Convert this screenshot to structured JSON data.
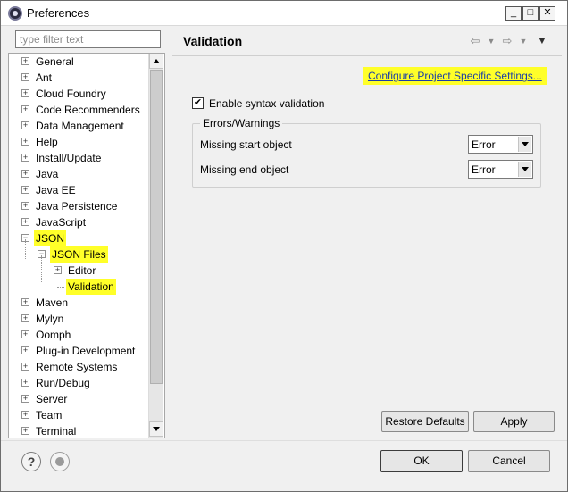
{
  "window": {
    "title": "Preferences",
    "minimize_icon": "minimize-icon",
    "maximize_icon": "maximize-icon",
    "close_icon": "close-icon"
  },
  "sidebar": {
    "filter_placeholder": "type filter text",
    "tree": [
      {
        "label": "General",
        "depth": 0,
        "expander": "+"
      },
      {
        "label": "Ant",
        "depth": 0,
        "expander": "+"
      },
      {
        "label": "Cloud Foundry",
        "depth": 0,
        "expander": "+"
      },
      {
        "label": "Code Recommenders",
        "depth": 0,
        "expander": "+"
      },
      {
        "label": "Data Management",
        "depth": 0,
        "expander": "+"
      },
      {
        "label": "Help",
        "depth": 0,
        "expander": "+"
      },
      {
        "label": "Install/Update",
        "depth": 0,
        "expander": "+"
      },
      {
        "label": "Java",
        "depth": 0,
        "expander": "+"
      },
      {
        "label": "Java EE",
        "depth": 0,
        "expander": "+"
      },
      {
        "label": "Java Persistence",
        "depth": 0,
        "expander": "+"
      },
      {
        "label": "JavaScript",
        "depth": 0,
        "expander": "+"
      },
      {
        "label": "JSON",
        "depth": 0,
        "expander": "−",
        "highlighted": true
      },
      {
        "label": "JSON Files",
        "depth": 1,
        "expander": "−",
        "highlighted": true
      },
      {
        "label": "Editor",
        "depth": 2,
        "expander": "+"
      },
      {
        "label": "Validation",
        "depth": 2,
        "expander": "",
        "highlighted": true,
        "selected": true
      },
      {
        "label": "Maven",
        "depth": 0,
        "expander": "+"
      },
      {
        "label": "Mylyn",
        "depth": 0,
        "expander": "+"
      },
      {
        "label": "Oomph",
        "depth": 0,
        "expander": "+"
      },
      {
        "label": "Plug-in Development",
        "depth": 0,
        "expander": "+"
      },
      {
        "label": "Remote Systems",
        "depth": 0,
        "expander": "+"
      },
      {
        "label": "Run/Debug",
        "depth": 0,
        "expander": "+"
      },
      {
        "label": "Server",
        "depth": 0,
        "expander": "+"
      },
      {
        "label": "Team",
        "depth": 0,
        "expander": "+"
      },
      {
        "label": "Terminal",
        "depth": 0,
        "expander": "+"
      }
    ]
  },
  "main": {
    "title": "Validation",
    "configure_link": "Configure Project Specific Settings...",
    "enable_syntax_label": "Enable syntax validation",
    "enable_syntax_checked": true,
    "group_title": "Errors/Warnings",
    "options": [
      {
        "label": "Missing start object",
        "value": "Error"
      },
      {
        "label": "Missing end object",
        "value": "Error"
      }
    ],
    "restore_defaults_label": "Restore Defaults",
    "apply_label": "Apply"
  },
  "footer": {
    "ok_label": "OK",
    "cancel_label": "Cancel",
    "help_icon": "help-icon",
    "record_icon": "record-icon"
  },
  "colors": {
    "highlight": "#ffff29",
    "link": "#1a3ea8",
    "background": "#f0f0f0"
  }
}
